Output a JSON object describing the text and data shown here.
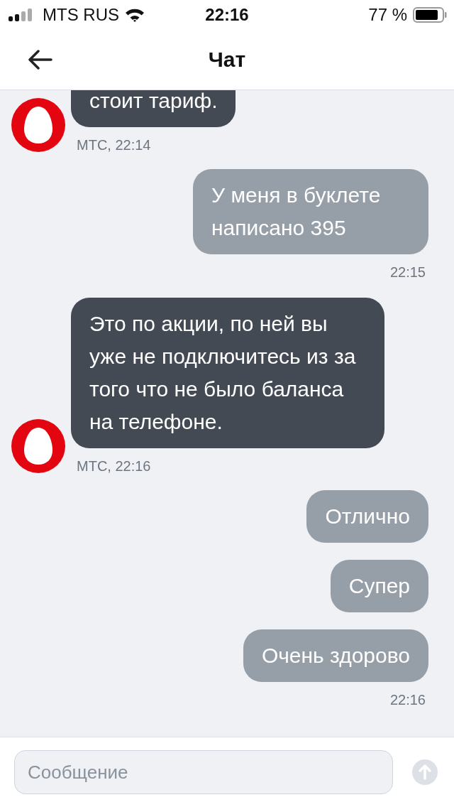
{
  "status_bar": {
    "carrier": "MTS RUS",
    "time": "22:16",
    "battery": "77 %"
  },
  "header": {
    "title": "Чат"
  },
  "messages": [
    {
      "kind": "incoming",
      "text": "стоит тариф.",
      "meta": "МТС, 22:14"
    },
    {
      "kind": "outgoing",
      "text": "У меня в буклете написано 395",
      "meta": "22:15"
    },
    {
      "kind": "incoming",
      "text": "Это по акции, по ней вы уже не подключитесь из за того что не было баланса на телефоне.",
      "meta": "МТС, 22:16"
    },
    {
      "kind": "outgoing",
      "text": "Отлично"
    },
    {
      "kind": "outgoing",
      "text": "Супер"
    },
    {
      "kind": "outgoing",
      "text": "Очень здорово",
      "meta": "22:16"
    }
  ],
  "composer": {
    "placeholder": "Сообщение"
  }
}
